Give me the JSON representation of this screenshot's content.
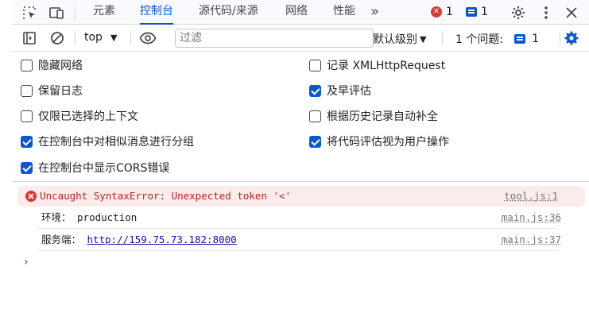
{
  "tabs": [
    {
      "label": "元素",
      "active": false
    },
    {
      "label": "控制台",
      "active": true
    },
    {
      "label": "源代码/来源",
      "active": false
    },
    {
      "label": "网络",
      "active": false
    },
    {
      "label": "性能",
      "active": false
    }
  ],
  "tabbar": {
    "more_tabs_glyph": "»",
    "error_count": "1",
    "message_count": "1"
  },
  "toolbar": {
    "context": "top",
    "filter_placeholder": "过滤",
    "levels_label": "默认级别",
    "issues_label": "1 个问题:",
    "issues_count": "1"
  },
  "settings": {
    "left": [
      {
        "label": "隐藏网络",
        "checked": false
      },
      {
        "label": "保留日志",
        "checked": false
      },
      {
        "label": "仅限已选择的上下文",
        "checked": false
      },
      {
        "label": "在控制台中对相似消息进行分组",
        "checked": true
      },
      {
        "label": "在控制台中显示CORS错误",
        "checked": true
      }
    ],
    "right": [
      {
        "label": "记录 XMLHttpRequest",
        "checked": false
      },
      {
        "label": "及早评估",
        "checked": true
      },
      {
        "label": "根据历史记录自动补全",
        "checked": false
      },
      {
        "label": "将代码评估视为用户操作",
        "checked": true
      }
    ]
  },
  "console": {
    "messages": [
      {
        "type": "error",
        "text": "Uncaught SyntaxError: Unexpected token '<'",
        "source": "tool.js:1"
      },
      {
        "type": "log",
        "text": "环境： production",
        "source": "main.js:36"
      },
      {
        "type": "log",
        "text_prefix": "服务端： ",
        "link": "http://159.75.73.182:8000",
        "source": "main.js:37"
      }
    ],
    "prompt_glyph": "›"
  },
  "colors": {
    "accent": "#0b57d0",
    "error": "#dc362e",
    "error_bg": "#fcebeb"
  }
}
